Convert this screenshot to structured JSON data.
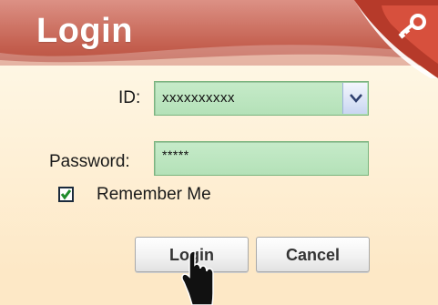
{
  "header": {
    "title": "Login",
    "corner_icon": "key-icon"
  },
  "form": {
    "id_label": "ID:",
    "id_value": "xxxxxxxxxx",
    "password_label": "Password:",
    "password_value": "*****",
    "remember_label": "Remember Me",
    "remember_checked": true
  },
  "buttons": {
    "login_label": "Login",
    "cancel_label": "Cancel"
  },
  "cursor": "hand-pointer-icon",
  "colors": {
    "header": "#c45f4f",
    "field_bg": "#c6ebc9",
    "panel_bg": "#fde8c6"
  }
}
